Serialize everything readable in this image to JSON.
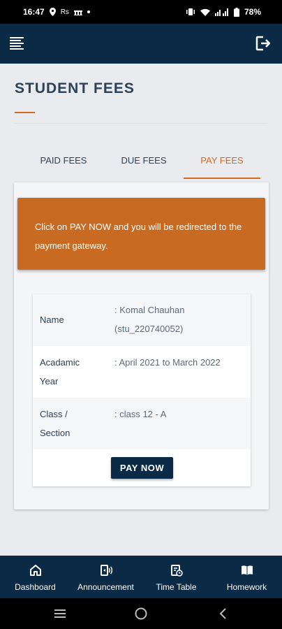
{
  "status_bar": {
    "time": "16:47",
    "left_extra": "Rs",
    "battery": "78%",
    "icons": [
      "location-icon",
      "bank-icon",
      "dot-icon",
      "vibrate-icon",
      "wifi-icon",
      "signal-icon",
      "battery-icon"
    ]
  },
  "app_bar": {
    "menu_icon": "menu-icon",
    "logout_icon": "logout-icon"
  },
  "page": {
    "title": "STUDENT FEES"
  },
  "tabs": [
    {
      "label": "PAID FEES",
      "active": false
    },
    {
      "label": "DUE FEES",
      "active": false
    },
    {
      "label": "PAY FEES",
      "active": true
    }
  ],
  "notice": {
    "text": "Click on PAY NOW and you will be redirected to the payment gateway."
  },
  "info": {
    "rows": [
      {
        "label": "Name",
        "value_line1": ": Komal Chauhan",
        "value_line2": "(stu_220740052)"
      },
      {
        "label_line1": "Acadamic",
        "label_line2": "Year",
        "value": ": April 2021 to March 2022"
      },
      {
        "label_line1": "Class /",
        "label_line2": "Section",
        "value": ": class 12 - A"
      }
    ]
  },
  "pay_button": {
    "label": "PAY NOW"
  },
  "bottom_nav": [
    {
      "label": "Dashboard",
      "icon": "home-icon"
    },
    {
      "label": "Announcement",
      "icon": "announcement-icon"
    },
    {
      "label": "Time Table",
      "icon": "timetable-icon"
    },
    {
      "label": "Homework",
      "icon": "book-icon"
    }
  ],
  "colors": {
    "primary": "#0b2a45",
    "accent": "#d46a1f",
    "notice_bg": "#c86a22"
  }
}
